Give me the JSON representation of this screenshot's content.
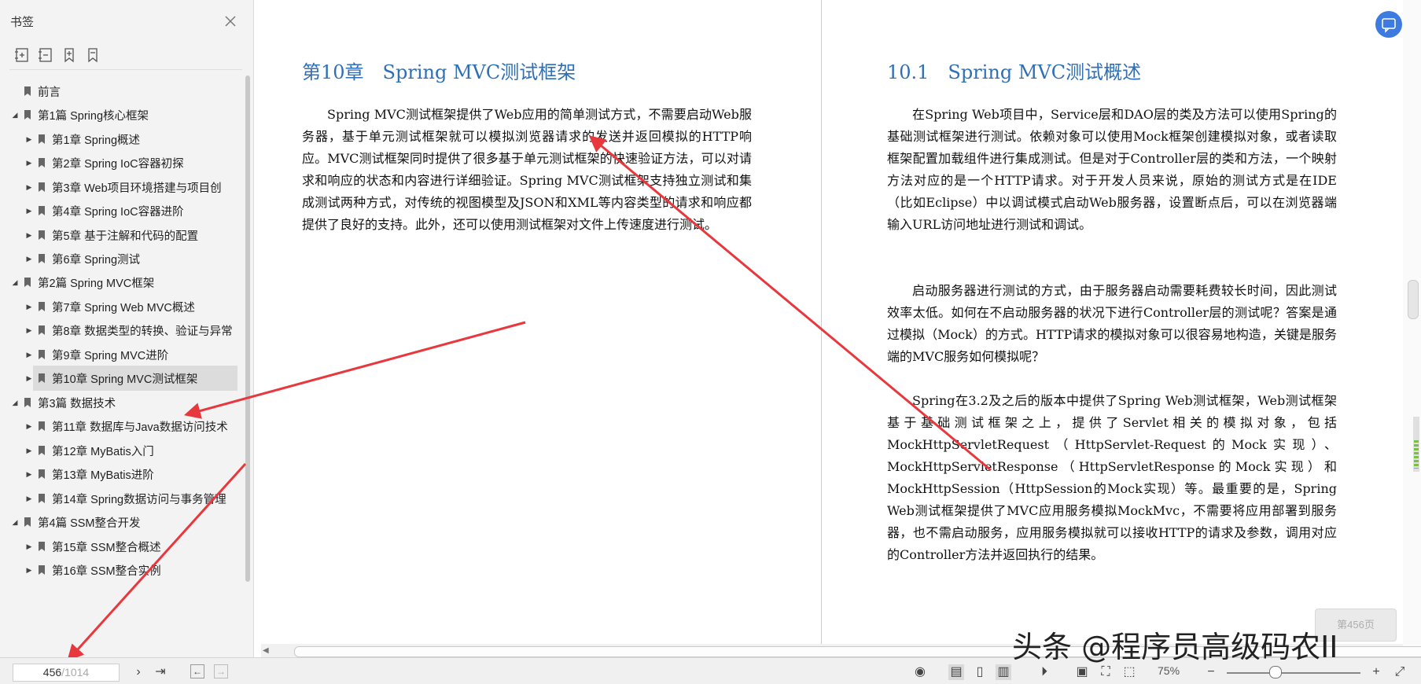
{
  "sidebar": {
    "title": "书签",
    "items": [
      {
        "label": "前言",
        "level": 0,
        "expanded": null
      },
      {
        "label": "第1篇 Spring核心框架",
        "level": 0,
        "expanded": true
      },
      {
        "label": "第1章 Spring概述",
        "level": 1,
        "expanded": false
      },
      {
        "label": "第2章 Spring IoC容器初探",
        "level": 1,
        "expanded": false
      },
      {
        "label": "第3章 Web项目环境搭建与项目创",
        "level": 1,
        "expanded": false
      },
      {
        "label": "第4章 Spring IoC容器进阶",
        "level": 1,
        "expanded": false
      },
      {
        "label": "第5章 基于注解和代码的配置",
        "level": 1,
        "expanded": false
      },
      {
        "label": "第6章 Spring测试",
        "level": 1,
        "expanded": false
      },
      {
        "label": "第2篇 Spring MVC框架",
        "level": 0,
        "expanded": true
      },
      {
        "label": "第7章 Spring Web MVC概述",
        "level": 1,
        "expanded": false
      },
      {
        "label": "第8章 数据类型的转换、验证与异常",
        "level": 1,
        "expanded": false
      },
      {
        "label": "第9章 Spring MVC进阶",
        "level": 1,
        "expanded": false
      },
      {
        "label": "第10章 Spring MVC测试框架",
        "level": 1,
        "expanded": false,
        "selected": true
      },
      {
        "label": "第3篇 数据技术",
        "level": 0,
        "expanded": true
      },
      {
        "label": "第11章 数据库与Java数据访问技术",
        "level": 1,
        "expanded": false
      },
      {
        "label": "第12章 MyBatis入门",
        "level": 1,
        "expanded": false
      },
      {
        "label": "第13章 MyBatis进阶",
        "level": 1,
        "expanded": false
      },
      {
        "label": "第14章 Spring数据访问与事务管理",
        "level": 1,
        "expanded": false
      },
      {
        "label": "第4篇 SSM整合开发",
        "level": 0,
        "expanded": true
      },
      {
        "label": "第15章 SSM整合概述",
        "level": 1,
        "expanded": false
      },
      {
        "label": "第16章 SSM整合实例",
        "level": 1,
        "expanded": false
      }
    ]
  },
  "left_page": {
    "heading": "第10章　Spring MVC测试框架",
    "paragraph": "Spring MVC测试框架提供了Web应用的简单测试方式，不需要启动Web服务器，基于单元测试框架就可以模拟浏览器请求的发送并返回模拟的HTTP响应。MVC测试框架同时提供了很多基于单元测试框架的快速验证方法，可以对请求和响应的状态和内容进行详细验证。Spring MVC测试框架支持独立测试和集成测试两种方式，对传统的视图模型及JSON和XML等内容类型的请求和响应都提供了良好的支持。此外，还可以使用测试框架对文件上传速度进行测试。"
  },
  "right_page": {
    "heading": "10.1　Spring MVC测试概述",
    "paragraphs": [
      "在Spring Web项目中，Service层和DAO层的类及方法可以使用Spring的基础测试框架进行测试。依赖对象可以使用Mock框架创建模拟对象，或者读取框架配置加载组件进行集成测试。但是对于Controller层的类和方法，一个映射方法对应的是一个HTTP请求。对于开发人员来说，原始的测试方式是在IDE（比如Eclipse）中以调试模式启动Web服务器，设置断点后，可以在浏览器端输入URL访问地址进行测试和调试。",
      "启动服务器进行测试的方式，由于服务器启动需要耗费较长时间，因此测试效率太低。如何在不启动服务器的状况下进行Controller层的测试呢？答案是通过模拟（Mock）的方式。HTTP请求的模拟对象可以很容易地构造，关键是服务端的MVC服务如何模拟呢？",
      "Spring在3.2及之后的版本中提供了Spring Web测试框架，Web测试框架基于基础测试框架之上，提供了Servlet相关的模拟对象，包括MockHttpServletRequest（HttpServlet-Request的Mock实现）、MockHttpServletResponse（HttpServletResponse的Mock实现）和MockHttpSession（HttpSession的Mock实现）等。最重要的是，Spring Web测试框架提供了MVC应用服务模拟MockMvc，不需要将应用部署到服务器，也不需启动服务，应用服务模拟就可以接收HTTP的请求及参数，调用对应的Controller方法并返回执行的结果。"
    ]
  },
  "page_tip": "第456页",
  "status": {
    "current_page": "456",
    "total_pages": "/1014",
    "zoom": "75%"
  },
  "watermark": "头条 @程序员高级码农II",
  "colors": {
    "heading": "#2f6fb5",
    "annotation_arrow": "#e8383d",
    "sidebar_bg": "#f3f3f3",
    "selected_bg": "#dcdcdc"
  }
}
